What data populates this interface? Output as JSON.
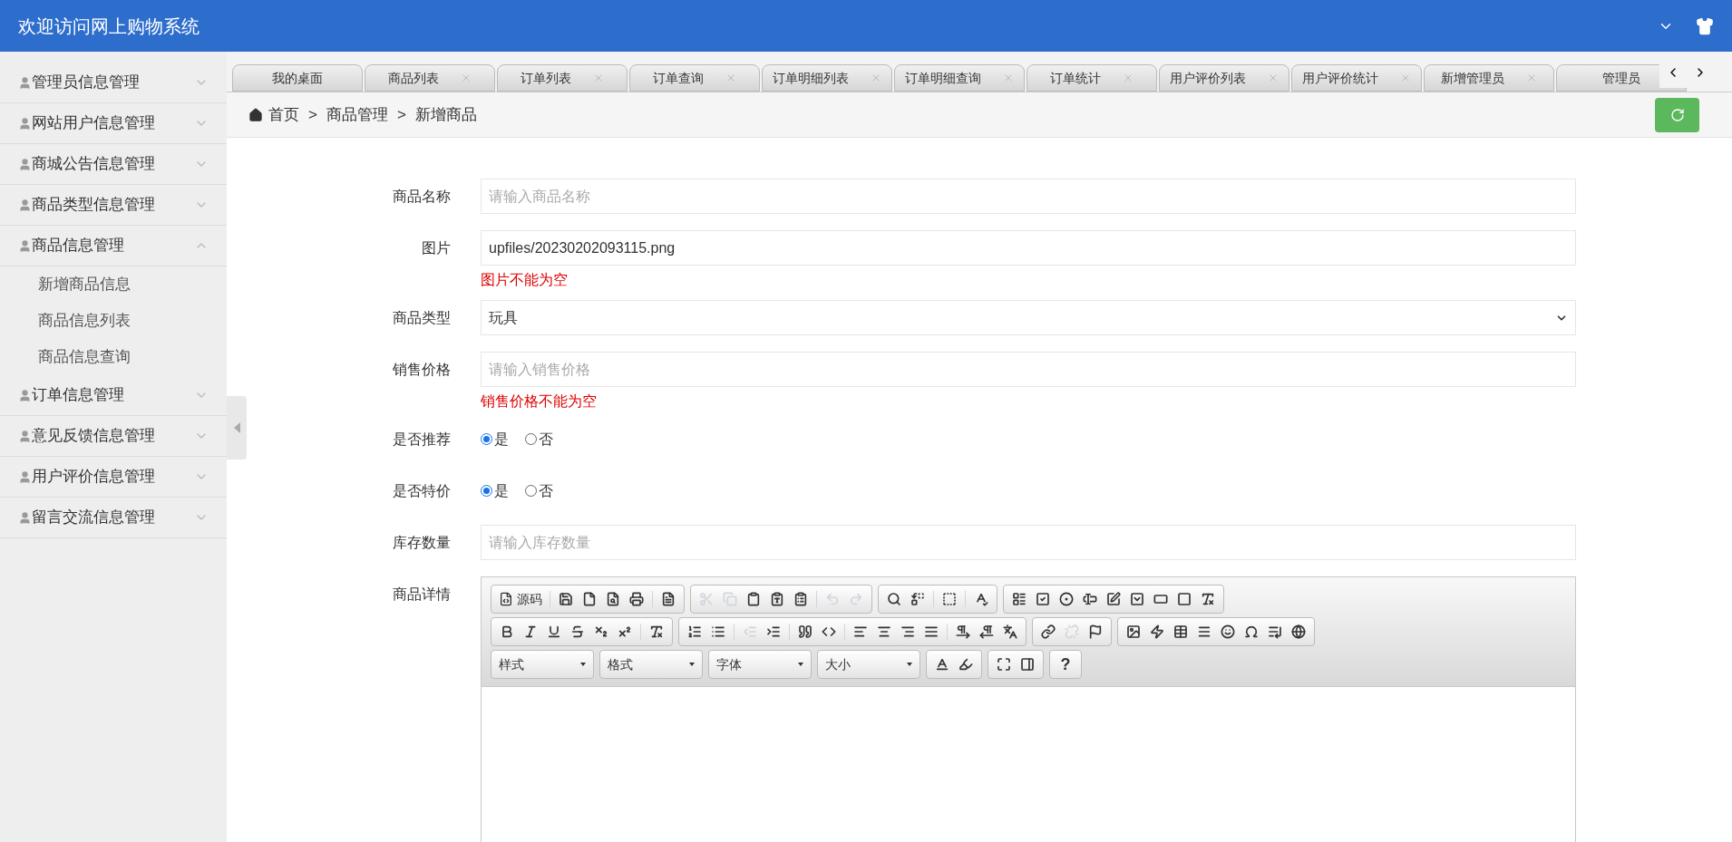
{
  "header": {
    "title": "欢迎访问网上购物系统"
  },
  "sidebar": {
    "items": [
      {
        "label": "管理员信息管理",
        "expanded": false
      },
      {
        "label": "网站用户信息管理",
        "expanded": false
      },
      {
        "label": "商城公告信息管理",
        "expanded": false
      },
      {
        "label": "商品类型信息管理",
        "expanded": false
      },
      {
        "label": "商品信息管理",
        "expanded": true,
        "children": [
          {
            "label": "新增商品信息"
          },
          {
            "label": "商品信息列表"
          },
          {
            "label": "商品信息查询"
          }
        ]
      },
      {
        "label": "订单信息管理",
        "expanded": false
      },
      {
        "label": "意见反馈信息管理",
        "expanded": false
      },
      {
        "label": "用户评价信息管理",
        "expanded": false
      },
      {
        "label": "留言交流信息管理",
        "expanded": false
      }
    ]
  },
  "tabs": [
    {
      "label": "我的桌面",
      "closable": false,
      "selected": false
    },
    {
      "label": "商品列表",
      "closable": true,
      "selected": false
    },
    {
      "label": "订单列表",
      "closable": true,
      "selected": false
    },
    {
      "label": "订单查询",
      "closable": true,
      "selected": false
    },
    {
      "label": "订单明细列表",
      "closable": true,
      "selected": false
    },
    {
      "label": "订单明细查询",
      "closable": true,
      "selected": false
    },
    {
      "label": "订单统计",
      "closable": true,
      "selected": false
    },
    {
      "label": "用户评价列表",
      "closable": true,
      "selected": false
    },
    {
      "label": "用户评价统计",
      "closable": true,
      "selected": false
    },
    {
      "label": "新增管理员",
      "closable": true,
      "selected": false
    },
    {
      "label": "管理员",
      "closable": false,
      "selected": false
    }
  ],
  "breadcrumb": {
    "separator": ">",
    "items": [
      "首页",
      "商品管理",
      "新增商品"
    ]
  },
  "form": {
    "fields": [
      {
        "kind": "text",
        "label": "商品名称",
        "placeholder": "请输入商品名称"
      },
      {
        "kind": "text",
        "label": "图片",
        "value": "upfiles/20230202093115.png",
        "error": "图片不能为空"
      },
      {
        "kind": "select",
        "label": "商品类型",
        "value": "玩具"
      },
      {
        "kind": "text",
        "label": "销售价格",
        "placeholder": "请输入销售价格",
        "error": "销售价格不能为空"
      },
      {
        "kind": "radio",
        "label": "是否推荐",
        "options": [
          {
            "label": "是",
            "selected": true
          },
          {
            "label": "否",
            "selected": false
          }
        ]
      },
      {
        "kind": "radio",
        "label": "是否特价",
        "options": [
          {
            "label": "是",
            "selected": true
          },
          {
            "label": "否",
            "selected": false
          }
        ]
      },
      {
        "kind": "text",
        "label": "库存数量",
        "placeholder": "请输入库存数量"
      },
      {
        "kind": "editor",
        "label": "商品详情",
        "source_label": "源码",
        "combos": [
          "样式",
          "格式",
          "字体",
          "大小"
        ],
        "help": "?"
      }
    ]
  }
}
